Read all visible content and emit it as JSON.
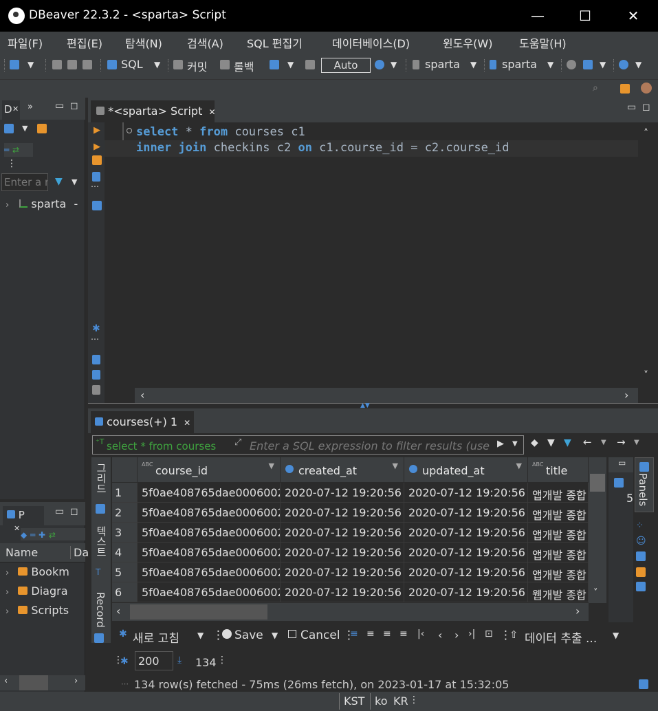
{
  "window": {
    "title": "DBeaver 22.3.2 - <sparta> Script"
  },
  "menu": [
    "파일(F)",
    "편집(E)",
    "탐색(N)",
    "검색(A)",
    "SQL 편집기",
    "데이터베이스(D)",
    "윈도우(W)",
    "도움말(H)"
  ],
  "toolbar": {
    "sql_label": "SQL",
    "commit_label": "커밋",
    "rollback_label": "롤백",
    "auto_label": "Auto",
    "datasource_label": "sparta",
    "schema_label": "sparta"
  },
  "navigator": {
    "tab_label": "D",
    "filter_placeholder": "Enter a r",
    "tree_item": "sparta",
    "tree_suffix": "-"
  },
  "projects": {
    "tab_label": "P",
    "header_name": "Name",
    "header_da": "Da",
    "items": [
      "Bookm",
      "Diagra",
      "Scripts"
    ]
  },
  "editor": {
    "tab_label": "*<sparta> Script",
    "line1": {
      "kw1": "select",
      "t1": " * ",
      "kw2": "from",
      "t2": " courses c1"
    },
    "line2": {
      "kw1": "inner",
      "t1": " ",
      "kw2": "join",
      "t2": " checkins c2 ",
      "kw3": "on",
      "t3": " c1.course_id = c2.course_id"
    }
  },
  "results": {
    "tab_label": "courses(+) 1",
    "filter_hint": "select * from courses",
    "filter_placeholder": "Enter a SQL expression to filter results (use",
    "side_tabs": {
      "grid": "그리드",
      "text": "텍스트",
      "record": "Record"
    },
    "columns": [
      "course_id",
      "created_at",
      "updated_at",
      "title"
    ],
    "rows": [
      [
        "1",
        "5f0ae408765dae0006002",
        "2020-07-12 19:20:56",
        "2020-07-12 19:20:56",
        "앱개발 종합"
      ],
      [
        "2",
        "5f0ae408765dae0006002",
        "2020-07-12 19:20:56",
        "2020-07-12 19:20:56",
        "앱개발 종합"
      ],
      [
        "3",
        "5f0ae408765dae0006002",
        "2020-07-12 19:20:56",
        "2020-07-12 19:20:56",
        "앱개발 종합"
      ],
      [
        "4",
        "5f0ae408765dae0006002",
        "2020-07-12 19:20:56",
        "2020-07-12 19:20:56",
        "앱개발 종합"
      ],
      [
        "5",
        "5f0ae408765dae0006002",
        "2020-07-12 19:20:56",
        "2020-07-12 19:20:56",
        "앱개발 종합"
      ],
      [
        "6",
        "5f0ae408765dae0006002",
        "2020-07-12 19:20:56",
        "2020-07-12 19:20:56",
        "웹개발 종합"
      ]
    ],
    "panels_label": "Panels",
    "panel_value": "5",
    "refresh_label": "새로 고침",
    "save_label": "Save",
    "cancel_label": "Cancel",
    "export_label": "데이터 추출 ...",
    "fetch_size": "200",
    "row_count": "134",
    "status": "134 row(s) fetched - 75ms (26ms fetch), on 2023-01-17 at 15:32:05"
  },
  "statusbar": {
    "timezone": "KST",
    "locale_lang": "ko",
    "locale_country": "KR"
  }
}
